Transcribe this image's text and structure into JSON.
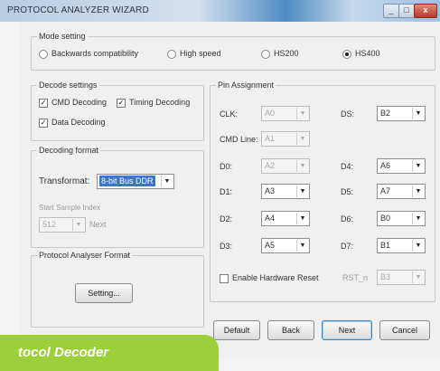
{
  "window": {
    "title": "PROTOCOL ANALYZER WIZARD",
    "minimize_glyph": "_",
    "maximize_glyph": "□",
    "close_glyph": "x"
  },
  "mode_setting": {
    "label": "Mode setting",
    "options": [
      "Backwards compatibility",
      "High speed",
      "HS200",
      "HS400"
    ],
    "selected": "HS400"
  },
  "decode_settings": {
    "label": "Decode settings",
    "cmd": {
      "label": "CMD Decoding",
      "checked": true
    },
    "timing": {
      "label": "Timing Decoding",
      "checked": true
    },
    "data": {
      "label": "Data Decoding",
      "checked": true
    },
    "check_glyph": "✓"
  },
  "decoding_format": {
    "label": "Decoding format",
    "transformat_label": "Transformat:",
    "transformat_value": "8-bit Bus DDR",
    "start_sample_label": "Start Sample Index",
    "start_sample_value": "512",
    "next_label": "Next"
  },
  "protocol_analyser_format": {
    "label": "Protocol Analyser Format",
    "setting_button": "Setting..."
  },
  "pin_assignment": {
    "label": "Pin Assignment",
    "clk": {
      "label": "CLK:",
      "value": "A0"
    },
    "ds": {
      "label": "DS:",
      "value": "B2"
    },
    "cmd_line": {
      "label": "CMD Line:",
      "value": "A1"
    },
    "d0": {
      "label": "D0:",
      "value": "A2"
    },
    "d1": {
      "label": "D1:",
      "value": "A3"
    },
    "d2": {
      "label": "D2:",
      "value": "A4"
    },
    "d3": {
      "label": "D3:",
      "value": "A5"
    },
    "d4": {
      "label": "D4:",
      "value": "A6"
    },
    "d5": {
      "label": "D5:",
      "value": "A7"
    },
    "d6": {
      "label": "D6:",
      "value": "B0"
    },
    "d7": {
      "label": "D7:",
      "value": "B1"
    },
    "hw_reset": {
      "label": "Enable Hardware Reset",
      "checked": false,
      "rst_label": "RST_n",
      "value": "B3"
    }
  },
  "buttons": {
    "default": "Default",
    "back": "Back",
    "next": "Next",
    "cancel": "Cancel"
  },
  "icons": {
    "dropdown": "▼"
  },
  "banner": {
    "text": "tocol Decoder",
    "color": "#9ccf3a"
  }
}
